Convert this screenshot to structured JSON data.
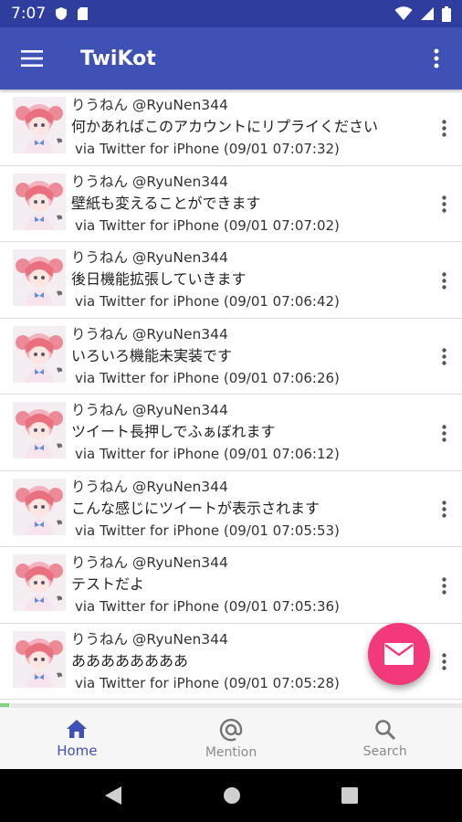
{
  "status_bar": {
    "time": "7:07"
  },
  "app_bar": {
    "title": "TwiKot"
  },
  "tweets": [
    {
      "user": "りうねん @RyuNen344",
      "text": "何かあればこのアカウントにリプライください",
      "via": "via Twitter for iPhone (09/01 07:07:32)"
    },
    {
      "user": "りうねん @RyuNen344",
      "text": "壁紙も変えることができます",
      "via": "via Twitter for iPhone (09/01 07:07:02)"
    },
    {
      "user": "りうねん @RyuNen344",
      "text": "後日機能拡張していきます",
      "via": "via Twitter for iPhone (09/01 07:06:42)"
    },
    {
      "user": "りうねん @RyuNen344",
      "text": "いろいろ機能未実装です",
      "via": "via Twitter for iPhone (09/01 07:06:26)"
    },
    {
      "user": "りうねん @RyuNen344",
      "text": "ツイート長押しでふぁぼれます",
      "via": "via Twitter for iPhone (09/01 07:06:12)"
    },
    {
      "user": "りうねん @RyuNen344",
      "text": "こんな感じにツイートが表示されます",
      "via": "via Twitter for iPhone (09/01 07:05:53)"
    },
    {
      "user": "りうねん @RyuNen344",
      "text": "テストだよ",
      "via": "via Twitter for iPhone (09/01 07:05:36)"
    },
    {
      "user": "りうねん @RyuNen344",
      "text": "ああああああああ",
      "via": "via Twitter for iPhone (09/01 07:05:28)"
    }
  ],
  "bottom_nav": {
    "home_label": "Home",
    "mention_label": "Mention",
    "search_label": "Search"
  },
  "colors": {
    "primary": "#3f51b5",
    "primary_dark": "#2f3e9e",
    "accent": "#f4397a"
  },
  "icons": {
    "menu": "menu-icon",
    "overflow": "more-vert-icon",
    "fab": "mail-icon",
    "home": "home-icon",
    "mention": "at-sign-icon",
    "search": "search-icon"
  },
  "progress": {
    "fraction": 0.02
  }
}
